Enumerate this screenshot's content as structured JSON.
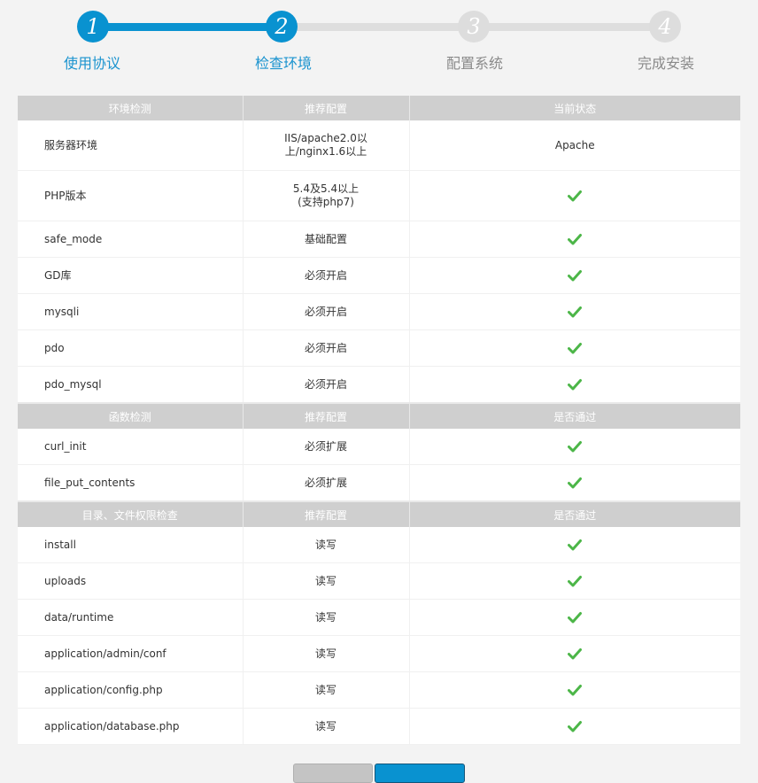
{
  "stepper": {
    "steps": [
      {
        "number": "1",
        "label": "使用协议"
      },
      {
        "number": "2",
        "label": "检查环境"
      },
      {
        "number": "3",
        "label": "配置系统"
      },
      {
        "number": "4",
        "label": "完成安装"
      }
    ],
    "current_step": 2,
    "colors": {
      "active": "#0992d0",
      "inactive": "#dddddd"
    }
  },
  "env_section": {
    "headers": [
      "环境检测",
      "推荐配置",
      "当前状态"
    ],
    "rows": [
      {
        "name": "服务器环境",
        "recommend_line1": "IIS/apache2.0以",
        "recommend_line2": "上/nginx1.6以上",
        "status": "Apache"
      },
      {
        "name": "PHP版本",
        "recommend_line1": "5.4及5.4以上",
        "recommend_line2": "(支持php7)",
        "status_icon": "check-icon"
      },
      {
        "name": "safe_mode",
        "recommend": "基础配置",
        "status_icon": "check-icon"
      },
      {
        "name": "GD库",
        "recommend": "必须开启",
        "status_icon": "check-icon"
      },
      {
        "name": "mysqli",
        "recommend": "必须开启",
        "status_icon": "check-icon"
      },
      {
        "name": "pdo",
        "recommend": "必须开启",
        "status_icon": "check-icon"
      },
      {
        "name": "pdo_mysql",
        "recommend": "必须开启",
        "status_icon": "check-icon"
      }
    ]
  },
  "func_section": {
    "headers": [
      "函数检测",
      "推荐配置",
      "是否通过"
    ],
    "rows": [
      {
        "name": "curl_init",
        "recommend": "必须扩展",
        "status_icon": "check-icon"
      },
      {
        "name": "file_put_contents",
        "recommend": "必须扩展",
        "status_icon": "check-icon"
      }
    ]
  },
  "dir_section": {
    "headers": [
      "目录、文件权限检查",
      "推荐配置",
      "是否通过"
    ],
    "rows": [
      {
        "name": "install",
        "recommend": "读写",
        "status_icon": "check-icon"
      },
      {
        "name": "uploads",
        "recommend": "读写",
        "status_icon": "check-icon"
      },
      {
        "name": "data/runtime",
        "recommend": "读写",
        "status_icon": "check-icon"
      },
      {
        "name": "application/admin/conf",
        "recommend": "读写",
        "status_icon": "check-icon"
      },
      {
        "name": "application/config.php",
        "recommend": "读写",
        "status_icon": "check-icon"
      },
      {
        "name": "application/database.php",
        "recommend": "读写",
        "status_icon": "check-icon"
      }
    ]
  },
  "check_color": "#4cb648"
}
